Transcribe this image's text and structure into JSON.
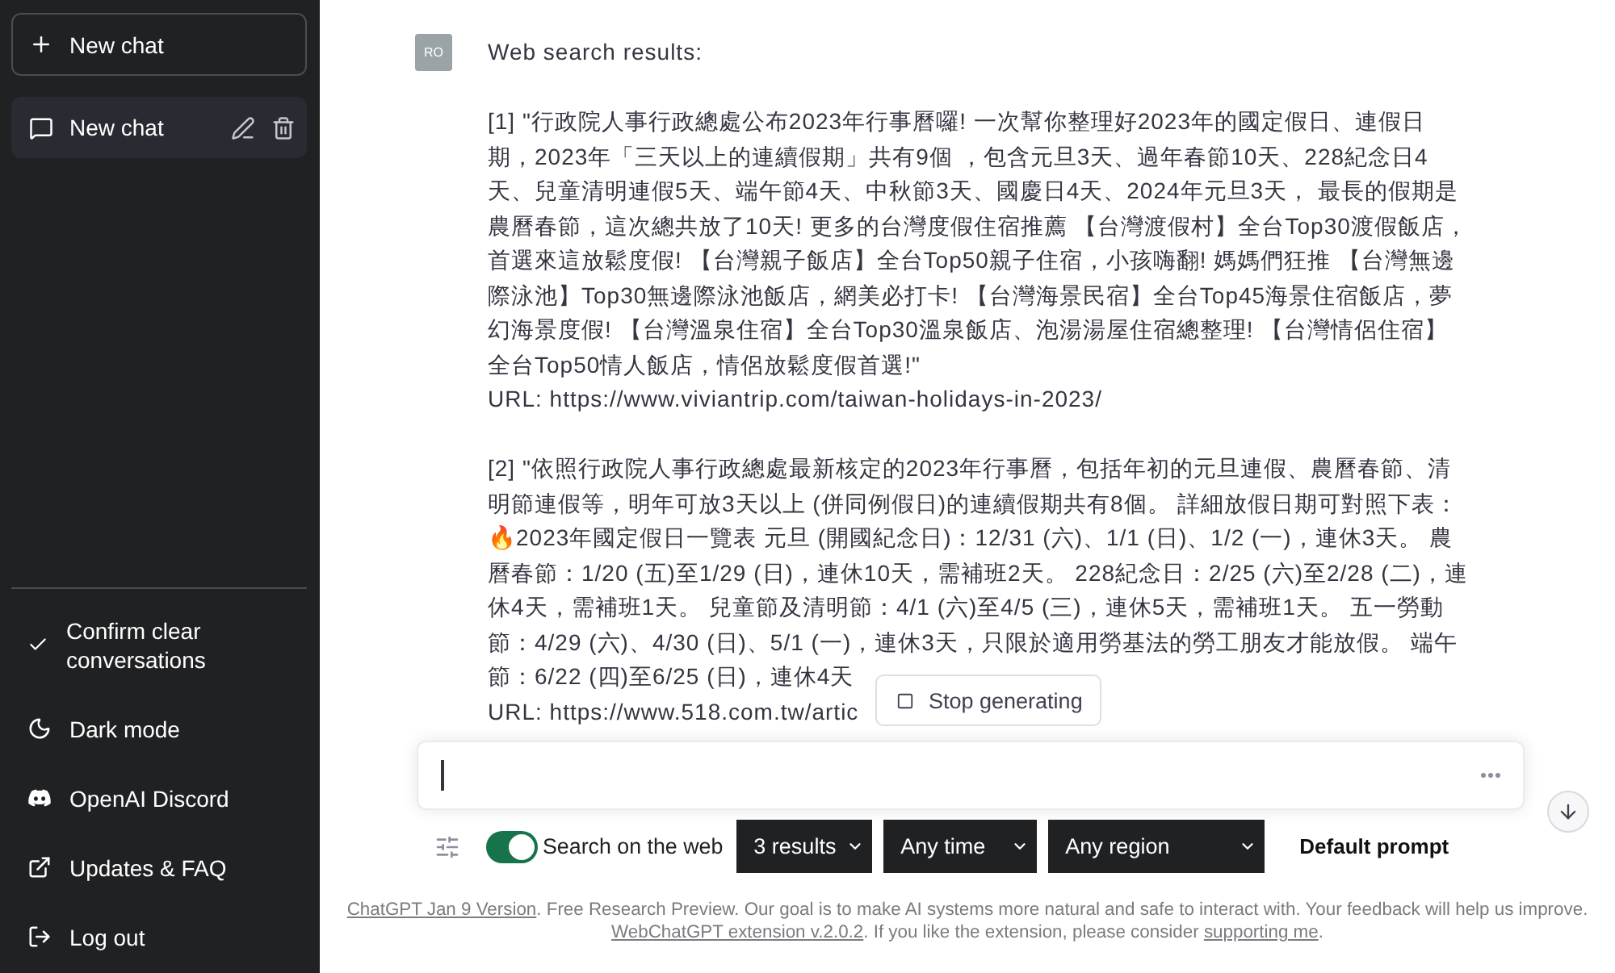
{
  "sidebar": {
    "new_chat": {
      "label": "New chat"
    },
    "chats": [
      {
        "title": "New chat",
        "selected": true
      }
    ],
    "menu": [
      {
        "kind": "check",
        "label": "Confirm clear conversations"
      },
      {
        "kind": "moon",
        "label": "Dark mode"
      },
      {
        "kind": "discord",
        "label": "OpenAI Discord"
      },
      {
        "kind": "external",
        "label": "Updates & FAQ"
      },
      {
        "kind": "logout",
        "label": "Log out"
      }
    ]
  },
  "message": {
    "avatar": "RO",
    "heading": "Web search results:",
    "results": [
      {
        "snippet": "[1] \"行政院人事行政總處公布2023年行事曆囉! 一次幫你整理好2023年的國定假日、連假日期，2023年「三天以上的連續假期」共有9個 ，包含元旦3天、過年春節10天、228紀念日4天、兒童清明連假5天、端午節4天、中秋節3天、國慶日4天、2024年元旦3天， 最長的假期是農曆春節，這次總共放了10天! 更多的台灣度假住宿推薦 【台灣渡假村】全台Top30渡假飯店，首選來這放鬆度假! 【台灣親子飯店】全台Top50親子住宿，小孩嗨翻! 媽媽們狂推 【台灣無邊際泳池】Top30無邊際泳池飯店，網美必打卡! 【台灣海景民宿】全台Top45海景住宿飯店，夢幻海景度假! 【台灣溫泉住宿】全台Top30溫泉飯店、泡湯湯屋住宿總整理! 【台灣情侶住宿】全台Top50情人飯店，情侶放鬆度假首選!\"",
        "url": "URL: https://www.viviantrip.com/taiwan-holidays-in-2023/"
      },
      {
        "snippet": "[2] \"依照行政院人事行政總處最新核定的2023年行事曆，包括年初的元旦連假、農曆春節、清明節連假等，明年可放3天以上 (併同例假日)的連續假期共有8個。 詳細放假日期可對照下表：🔥2023年國定假日一覽表 元旦 (開國紀念日)：12/31 (六)、1/1 (日)、1/2 (一)，連休3天。 農曆春節：1/20 (五)至1/29 (日)，連休10天，需補班2天。 228紀念日：2/25 (六)至2/28 (二)，連休4天，需補班1天。 兒童節及清明節：4/1 (六)至4/5 (三)，連休5天，需補班1天。 五一勞動節：4/29 (六)、4/30 (日)、5/1 (一)，連休3天，只限於適用勞基法的勞工朋友才能放假。 端午節：6/22 (四)至6/25 (日)，連休4天",
        "url": "URL: https://www.518.com.tw/artic"
      }
    ]
  },
  "stop_button": {
    "label": "Stop generating"
  },
  "toolbar": {
    "search_toggle": {
      "label": "Search on the web",
      "on": true
    },
    "selects": [
      {
        "value": "3 results"
      },
      {
        "value": "Any time"
      },
      {
        "value": "Any region"
      }
    ],
    "prompt": "Default prompt"
  },
  "footer": [
    [
      {
        "kind": "link",
        "text": "ChatGPT Jan 9 Version"
      },
      {
        "kind": "text",
        "text": ". Free Research Preview. Our goal is to make AI systems more natural and safe to interact with. Your feedback will help us improve."
      }
    ],
    [
      {
        "kind": "link",
        "text": "WebChatGPT extension v.2.0.2"
      },
      {
        "kind": "text",
        "text": ". If you like the extension, please consider "
      },
      {
        "kind": "link",
        "text": "supporting me"
      },
      {
        "kind": "text",
        "text": "."
      }
    ]
  ]
}
